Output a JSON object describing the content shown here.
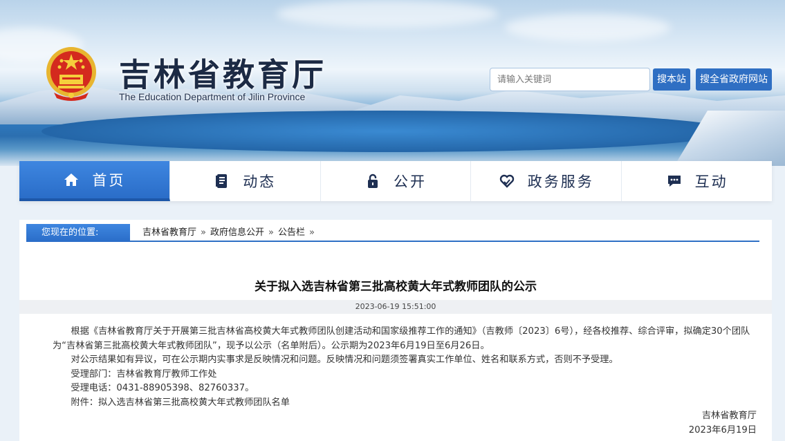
{
  "header": {
    "title": "吉林省教育厅",
    "subtitle": "The Education Department of Jilin Province",
    "search_placeholder": "请输入关键词",
    "btn_search_site": "搜本站",
    "btn_search_gov": "搜全省政府网站"
  },
  "nav": {
    "items": [
      {
        "label": "首页",
        "icon": "home-icon"
      },
      {
        "label": "动态",
        "icon": "document-icon"
      },
      {
        "label": "公开",
        "icon": "lock-icon"
      },
      {
        "label": "政务服务",
        "icon": "heart-hand-icon"
      },
      {
        "label": "互动",
        "icon": "chat-icon"
      }
    ]
  },
  "location": {
    "label": "您现在的位置:",
    "crumbs": [
      "吉林省教育厅",
      "政府信息公开",
      "公告栏"
    ],
    "separator": "»"
  },
  "article": {
    "title": "关于拟入选吉林省第三批高校黄大年式教师团队的公示",
    "datetime": "2023-06-19 15:51:00",
    "para1": "根据《吉林省教育厅关于开展第三批吉林省高校黄大年式教师团队创建活动和国家级推荐工作的通知》（吉教师〔2023〕6号），经各校推荐、综合评审，拟确定30个团队为“吉林省第三批高校黄大年式教师团队”，现予以公示（名单附后）。公示期为2023年6月19日至6月26日。",
    "para2": "对公示结果如有异议，可在公示期内实事求是反映情况和问题。反映情况和问题须签署真实工作单位、姓名和联系方式，否则不予受理。",
    "dept": "受理部门：吉林省教育厅教师工作处",
    "phone": "受理电话：0431-88905398、82760337。",
    "attachment": "附件：拟入选吉林省第三批高校黄大年式教师团队名单",
    "sign_org": "吉林省教育厅",
    "sign_date": "2023年6月19日"
  },
  "colors": {
    "accent": "#2f6fc3",
    "nav_active": "#3e86e0",
    "title_text": "#1c2a44"
  }
}
